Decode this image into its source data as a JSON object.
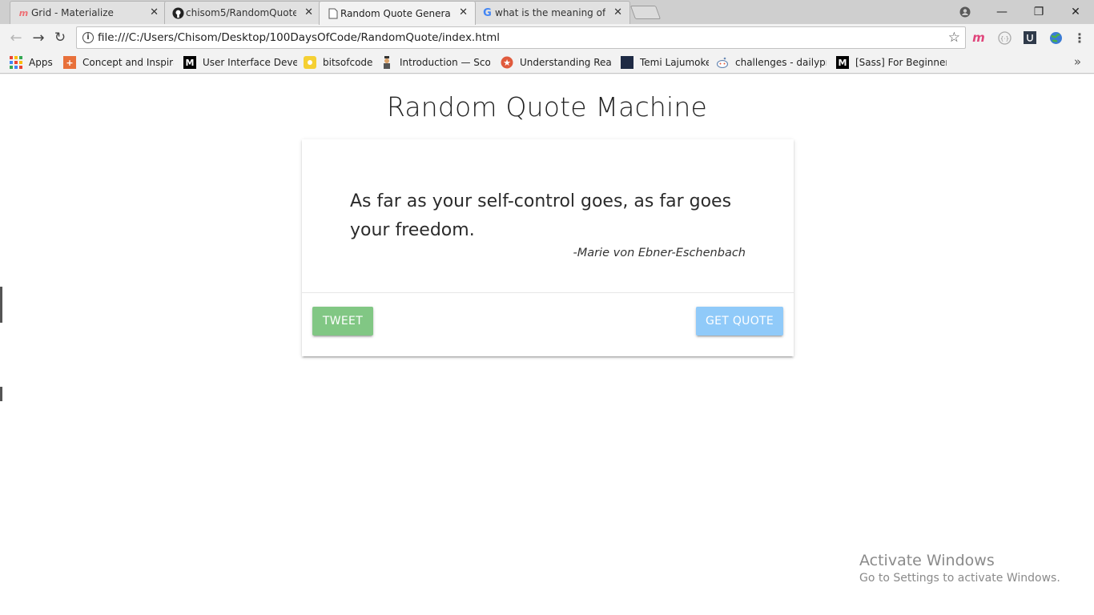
{
  "browser": {
    "tabs": [
      {
        "label": "Grid - Materialize",
        "icon": "materialize-logo-icon",
        "active": false
      },
      {
        "label": "chisom5/RandomQuote",
        "icon": "github-icon",
        "active": false
      },
      {
        "label": "Random Quote Generator",
        "icon": "page-icon",
        "active": true
      },
      {
        "label": "what is the meaning of js",
        "icon": "google-icon",
        "active": false
      }
    ],
    "close_glyph": "✕",
    "window_controls": {
      "minimize": "—",
      "restore": "❐",
      "close": "✕"
    },
    "url": "file:///C:/Users/Chisom/Desktop/100DaysOfCode/RandomQuote/index.html",
    "bookmarks": [
      {
        "label": "Apps",
        "icon": "apps-grid-icon"
      },
      {
        "label": "Concept and Inspirat",
        "icon": "plus-square-icon",
        "color": "#e8703a"
      },
      {
        "label": "User Interface Devel",
        "icon": "medium-m-icon",
        "color": "#000000"
      },
      {
        "label": "bitsofcode",
        "icon": "bitsofcode-icon",
        "color": "#f5d033"
      },
      {
        "label": "Introduction — Scot",
        "icon": "person-icon",
        "color": "#555555"
      },
      {
        "label": "Understanding Reac",
        "icon": "star-badge-icon",
        "color": "#e05a3c"
      },
      {
        "label": "Temi Lajumoke",
        "icon": "blog-icon",
        "color": "#1e2a44"
      },
      {
        "label": "challenges - dailypro",
        "icon": "reddit-icon",
        "color": "#6a8ab5"
      },
      {
        "label": "[Sass] For Beginners",
        "icon": "medium-m-icon",
        "color": "#000000"
      }
    ]
  },
  "page": {
    "title": "Random Quote Machine",
    "quote": "As far as your self-control goes, as far goes your freedom.",
    "author": "-Marie von Ebner-Eschenbach",
    "tweet_button": "TWEET",
    "get_quote_button": "GET QUOTE",
    "colors": {
      "tweet": "#81c784",
      "get_quote": "#90caf9"
    }
  },
  "watermark": {
    "line1": "Activate Windows",
    "line2": "Go to Settings to activate Windows."
  }
}
